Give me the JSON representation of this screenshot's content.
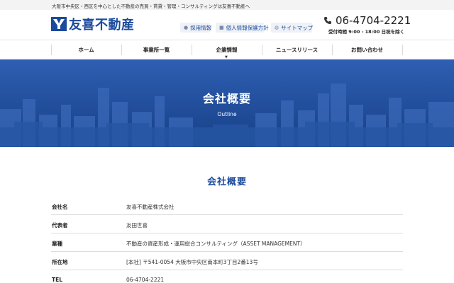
{
  "topbar": {
    "text": "大阪市中央区・西区を中心とした不動産の売買・賃貸・管理・コンサルティングは友喜不動産へ"
  },
  "logo": {
    "text": "友喜不動産"
  },
  "header": {
    "links": [
      {
        "label": "採用情報",
        "icon": "person-icon"
      },
      {
        "label": "個人情報保護方針",
        "icon": "lock-icon"
      },
      {
        "label": "サイトマップ",
        "icon": "globe-icon"
      }
    ],
    "phone": "06-4704-2221",
    "hours": "受付時間 9:00 - 18:00 日祝を除く"
  },
  "nav": {
    "items": [
      {
        "label": "ホーム"
      },
      {
        "label": "事業所一覧"
      },
      {
        "label": "企業情報"
      },
      {
        "label": "ニュースリリース"
      },
      {
        "label": "お問い合わせ"
      }
    ]
  },
  "hero": {
    "title": "会社概要",
    "subtitle": "Outline"
  },
  "section": {
    "title": "会社概要"
  },
  "table": {
    "rows": [
      {
        "key": "会社名",
        "value": "友喜不動産株式会社"
      },
      {
        "key": "代表者",
        "value": "友田世喜"
      },
      {
        "key": "業種",
        "value": "不動産の資産形成・運用総合コンサルティング（ASSET MANAGEMENT）"
      },
      {
        "key": "所在地",
        "value": "[本社] 〒541-0054 大阪市中央区南本町3丁目2番13号"
      },
      {
        "key": "TEL",
        "value": "06-4704-2221"
      }
    ]
  },
  "colors": {
    "brand": "#1b4a9c",
    "hero": "#1c4a9a",
    "topbar": "#f3f3f3"
  }
}
